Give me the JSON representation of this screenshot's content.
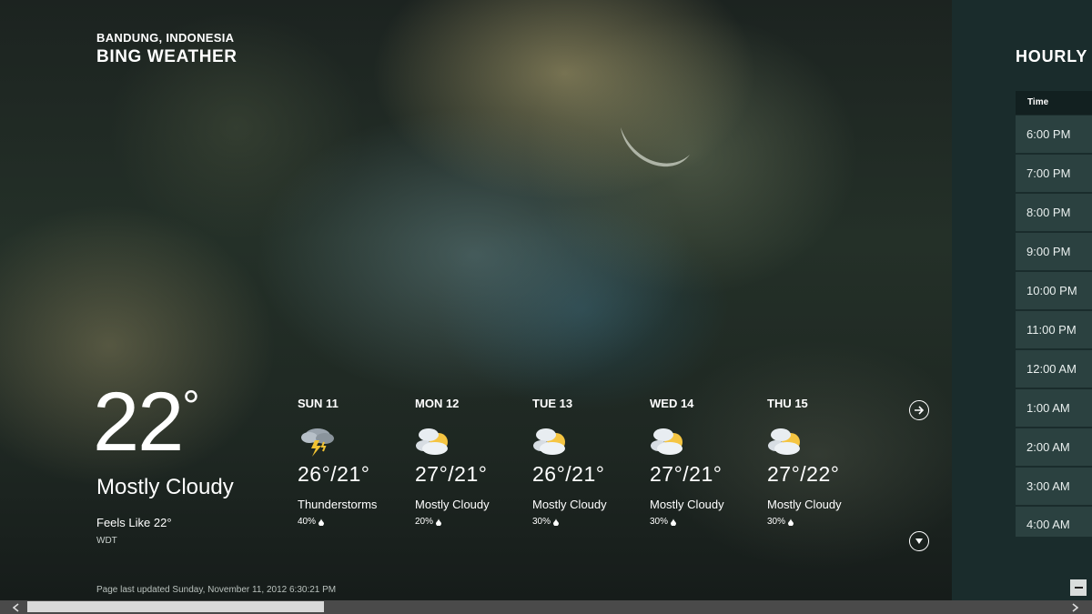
{
  "location": "BANDUNG, INDONESIA",
  "app_title": "BING WEATHER",
  "current": {
    "temperature": "22",
    "degree_symbol": "°",
    "condition": "Mostly Cloudy",
    "feels_like": "Feels Like 22°",
    "station": "WDT"
  },
  "forecast": [
    {
      "day": "SUN 11",
      "temp": "26°/21°",
      "condition": "Thunderstorms",
      "precip": "40%",
      "icon": "thunderstorm-icon"
    },
    {
      "day": "MON 12",
      "temp": "27°/21°",
      "condition": "Mostly Cloudy",
      "precip": "20%",
      "icon": "mostly-cloudy-icon"
    },
    {
      "day": "TUE 13",
      "temp": "26°/21°",
      "condition": "Mostly Cloudy",
      "precip": "30%",
      "icon": "mostly-cloudy-icon"
    },
    {
      "day": "WED 14",
      "temp": "27°/21°",
      "condition": "Mostly Cloudy",
      "precip": "30%",
      "icon": "mostly-cloudy-icon"
    },
    {
      "day": "THU 15",
      "temp": "27°/22°",
      "condition": "Mostly Cloudy",
      "precip": "30%",
      "icon": "mostly-cloudy-icon"
    }
  ],
  "last_updated": "Page last updated Sunday, November 11, 2012 6:30:21 PM",
  "hourly": {
    "title": "HOURLY",
    "column_header": "Time",
    "times": [
      "6:00 PM",
      "7:00 PM",
      "8:00 PM",
      "9:00 PM",
      "10:00 PM",
      "11:00 PM",
      "12:00 AM",
      "1:00 AM",
      "2:00 AM",
      "3:00 AM",
      "4:00 AM"
    ]
  },
  "colors": {
    "hourly_panel_bg": "#1a2c2c",
    "hourly_row_bg": "#2b4140",
    "hourly_header_bg": "#122020",
    "scrollbar_bg": "#4a4a4a",
    "scroll_thumb": "#d9d9d9"
  },
  "scroll": {
    "horizontal_position_fraction": 0.0
  }
}
